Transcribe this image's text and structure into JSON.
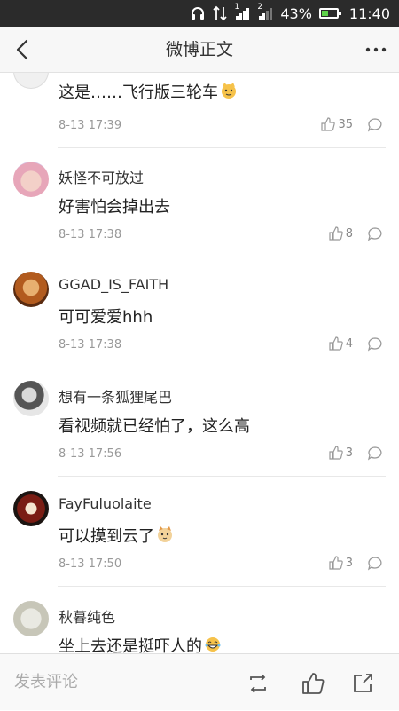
{
  "status_bar": {
    "battery_percent": "43%",
    "battery_level": 0.43,
    "time": "11:40",
    "signal_labels": [
      "1",
      "2"
    ]
  },
  "nav": {
    "title": "微博正文",
    "back_icon": "chevron-left-icon",
    "more_icon": "more-horizontal-icon"
  },
  "comments": [
    {
      "username": "",
      "content": "这是……飞行版三轮车",
      "emoji": "cat-face-emoji",
      "time": "8-13 17:39",
      "likes": "35"
    },
    {
      "username": "妖怪不可放过",
      "content": "好害怕会掉出去",
      "emoji": "",
      "time": "8-13 17:38",
      "likes": "8"
    },
    {
      "username": "GGAD_IS_FAITH",
      "content": "可可爱爱hhh",
      "emoji": "",
      "time": "8-13 17:38",
      "likes": "4"
    },
    {
      "username": "想有一条狐狸尾巴",
      "content": "看视频就已经怕了，这么高",
      "emoji": "",
      "time": "8-13 17:56",
      "likes": "3"
    },
    {
      "username": "FayFuluolaite",
      "content": "可以摸到云了",
      "emoji": "cat-face-emoji",
      "time": "8-13 17:50",
      "likes": "3"
    },
    {
      "username": "秋暮纯色",
      "content": "坐上去还是挺吓人的",
      "emoji": "laughing-tears-emoji",
      "time": "",
      "likes": ""
    }
  ],
  "bottom_bar": {
    "comment_placeholder": "发表评论",
    "icons": [
      "repost-icon",
      "like-icon",
      "share-icon"
    ]
  },
  "colors": {
    "status_bar_bg": "#2b2b2b",
    "nav_bg": "#f7f7f7",
    "secondary_text": "#999999",
    "battery_fill": "#5fd34a"
  }
}
